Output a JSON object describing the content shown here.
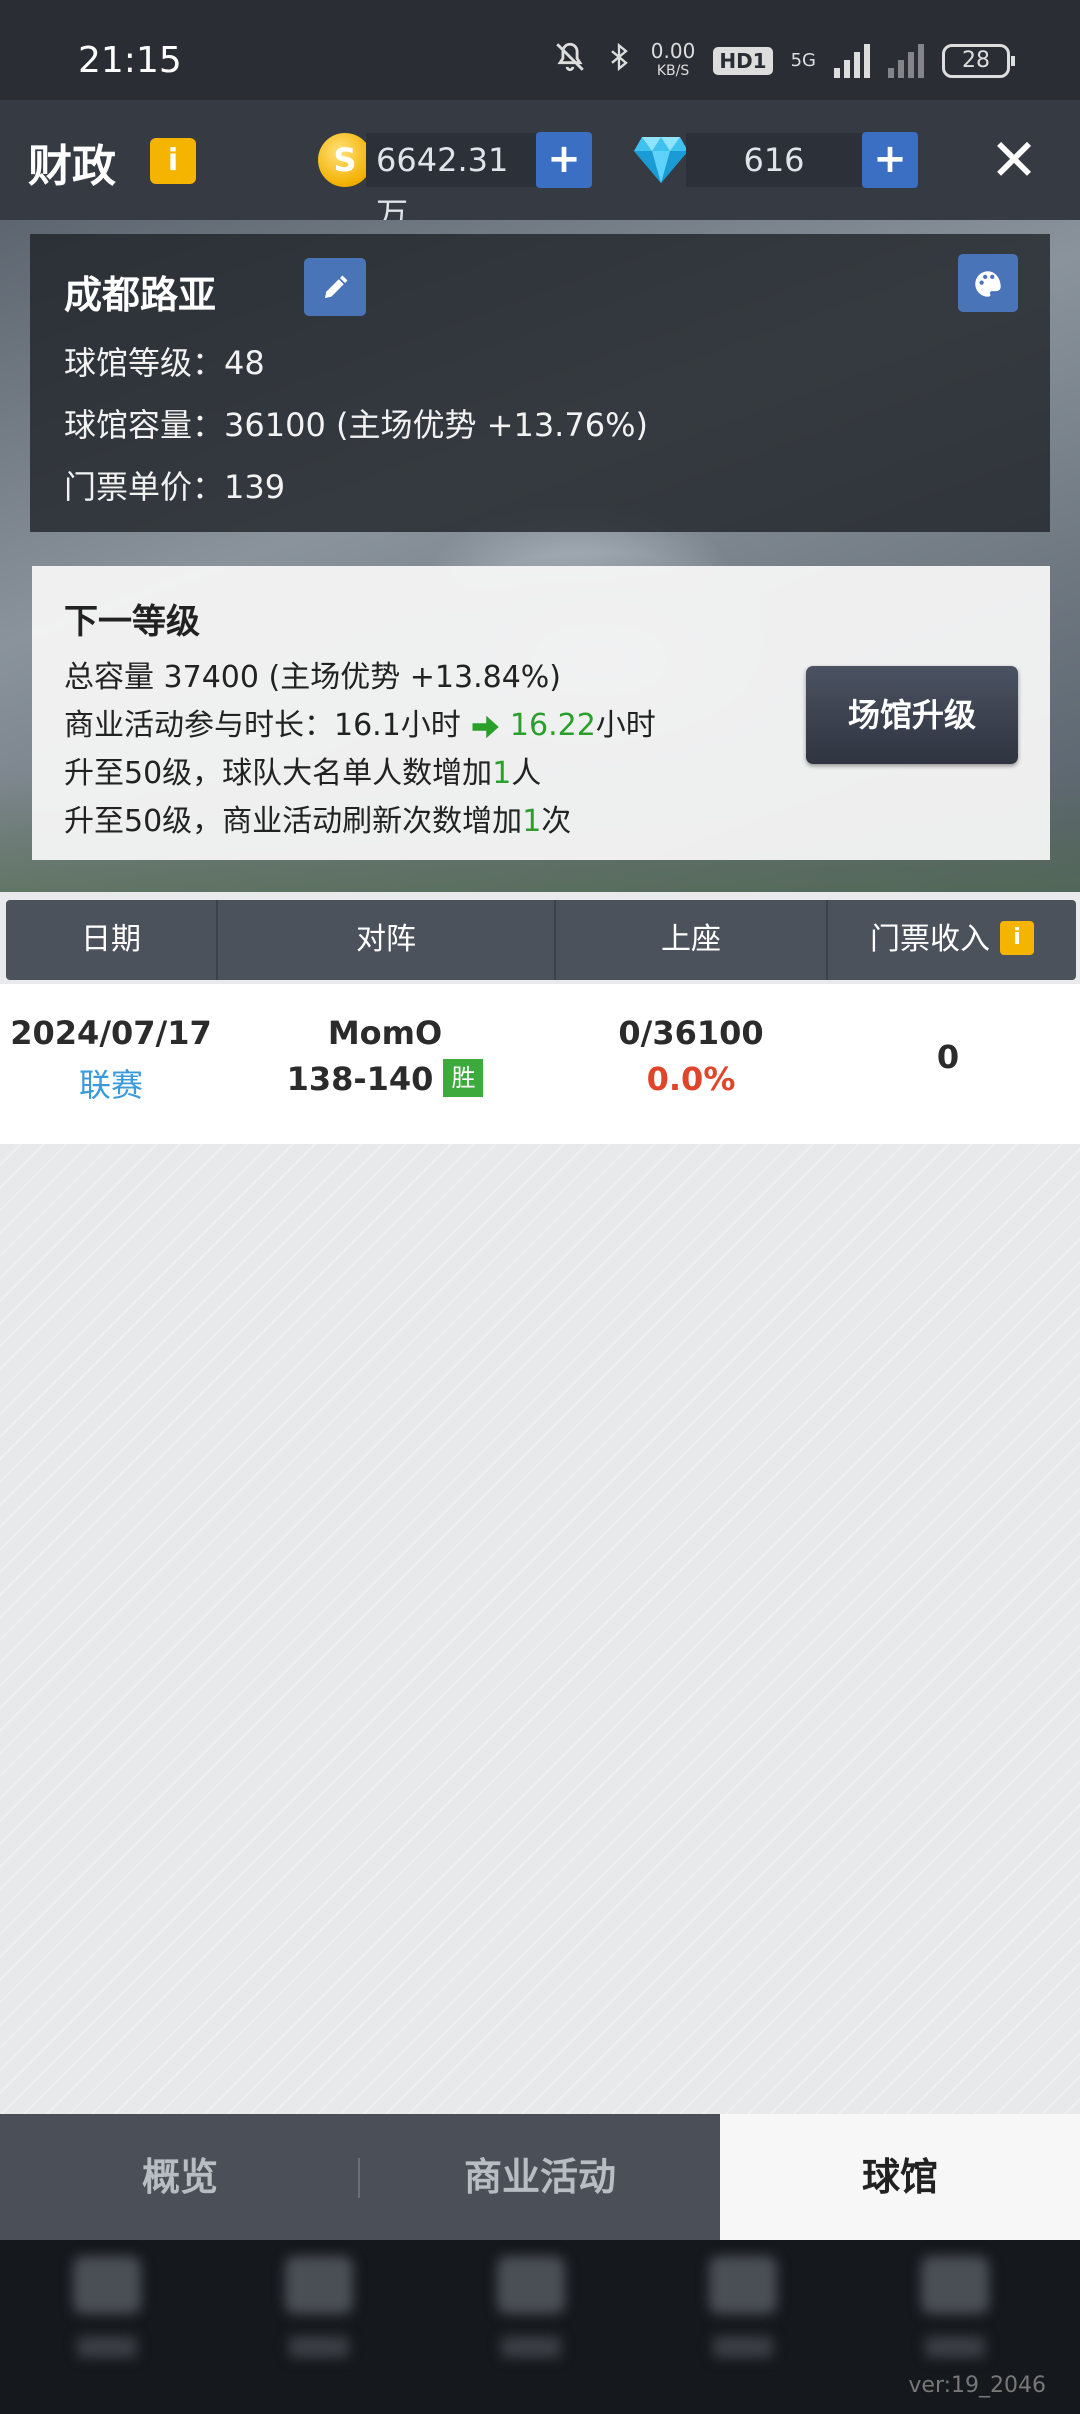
{
  "status_bar": {
    "time": "21:15",
    "net_speed": "0.00",
    "net_unit": "KB/S",
    "hd": "HD1",
    "network": "5G",
    "battery": "28"
  },
  "header": {
    "title": "财政",
    "info_icon": "i",
    "coins": "6642.31万",
    "coin_symbol": "S",
    "gems": "616",
    "plus": "+",
    "close": "✕"
  },
  "stadium": {
    "name": "成都路亚",
    "level_label": "球馆等级：",
    "level": "48",
    "capacity_label": "球馆容量：",
    "capacity": "36100 (主场优势 +13.76%)",
    "price_label": "门票单价：",
    "price": "139"
  },
  "next_level": {
    "title": "下一等级",
    "capacity_label": "总容量",
    "capacity": "37400 (主场优势 +13.84%)",
    "biz_label": "商业活动参与时长：",
    "biz_from": "16.1小时",
    "biz_to": "16.22",
    "biz_unit": "小时",
    "perk1_prefix": "升至50级，球队大名单人数增加",
    "perk1_num": "1",
    "perk1_suffix": "人",
    "perk2_prefix": "升至50级，商业活动刷新次数增加",
    "perk2_num": "1",
    "perk2_suffix": "次",
    "upgrade_button": "场馆升级"
  },
  "table": {
    "headers": [
      "日期",
      "对阵",
      "上座",
      "门票收入"
    ],
    "rows": [
      {
        "date": "2024/07/17",
        "type": "联赛",
        "opponent": "MomO",
        "score": "138-140",
        "result": "胜",
        "attendance": "0/36100",
        "attendance_pct": "0.0%",
        "revenue": "0"
      }
    ]
  },
  "tabs": [
    {
      "label": "概览",
      "active": false
    },
    {
      "label": "商业活动",
      "active": false
    },
    {
      "label": "球馆",
      "active": true
    }
  ],
  "version": "ver:19_2046",
  "colors": {
    "accent_blue": "#3a6fc3",
    "gold": "#f5b400",
    "win_green": "#3caa3c",
    "increase_green": "#2aa02a",
    "pct_red": "#e0452b",
    "link_blue": "#3a9bdc"
  }
}
